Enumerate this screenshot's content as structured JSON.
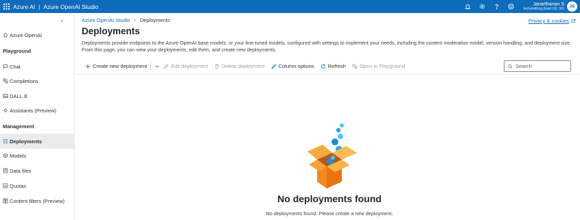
{
  "topbar": {
    "brand_primary": "Azure AI",
    "brand_separator": "|",
    "brand_secondary": "Azure OpenAI Studio",
    "icons": [
      "bell-icon",
      "gear-icon",
      "help-icon",
      "feedback-smiley-icon"
    ],
    "user_name": "Janarthanan S",
    "user_org": "techetaiKing (East US, S0)",
    "avatar_initials": "JS",
    "accent_color": "#0f6cbd"
  },
  "sidebar": {
    "collapse_glyph": "«",
    "top_item": {
      "label": "Azure OpenAI",
      "icon": "home-icon"
    },
    "sections": [
      {
        "title": "Playground",
        "items": [
          {
            "label": "Chat",
            "icon": "chat-icon"
          },
          {
            "label": "Completions",
            "icon": "completions-icon"
          },
          {
            "label": "DALL·E",
            "icon": "image-icon"
          },
          {
            "label": "Assistants (Preview)",
            "icon": "assistants-icon"
          }
        ]
      },
      {
        "title": "Management",
        "items": [
          {
            "label": "Deployments",
            "icon": "deployments-icon",
            "active": true
          },
          {
            "label": "Models",
            "icon": "models-icon"
          },
          {
            "label": "Data files",
            "icon": "data-files-icon"
          },
          {
            "label": "Quotas",
            "icon": "quotas-icon"
          },
          {
            "label": "Content filters (Preview)",
            "icon": "content-filter-icon"
          }
        ]
      }
    ]
  },
  "main": {
    "breadcrumb": {
      "root": "Azure OpenAI Studio",
      "current": "Deployments"
    },
    "privacy_link": "Privacy & cookies",
    "title": "Deployments",
    "description": "Deployments provide endpoints to the Azure OpenAI base models, or your fine-tuned models, configured with settings to implement your needs, including the content moderation model, version handling, and deployment size. From this page, you can view your deployments, edit them, and create new deployments.",
    "toolbar": {
      "create": "Create new deployment",
      "edit": "Edit deployment",
      "delete": "Delete deployment",
      "columns": "Column options",
      "refresh": "Refresh",
      "playground": "Open in Playground"
    },
    "search_placeholder": "Search",
    "empty_title": "No deployments found",
    "empty_subtitle": "No deployments found. Please create a new deployment."
  }
}
